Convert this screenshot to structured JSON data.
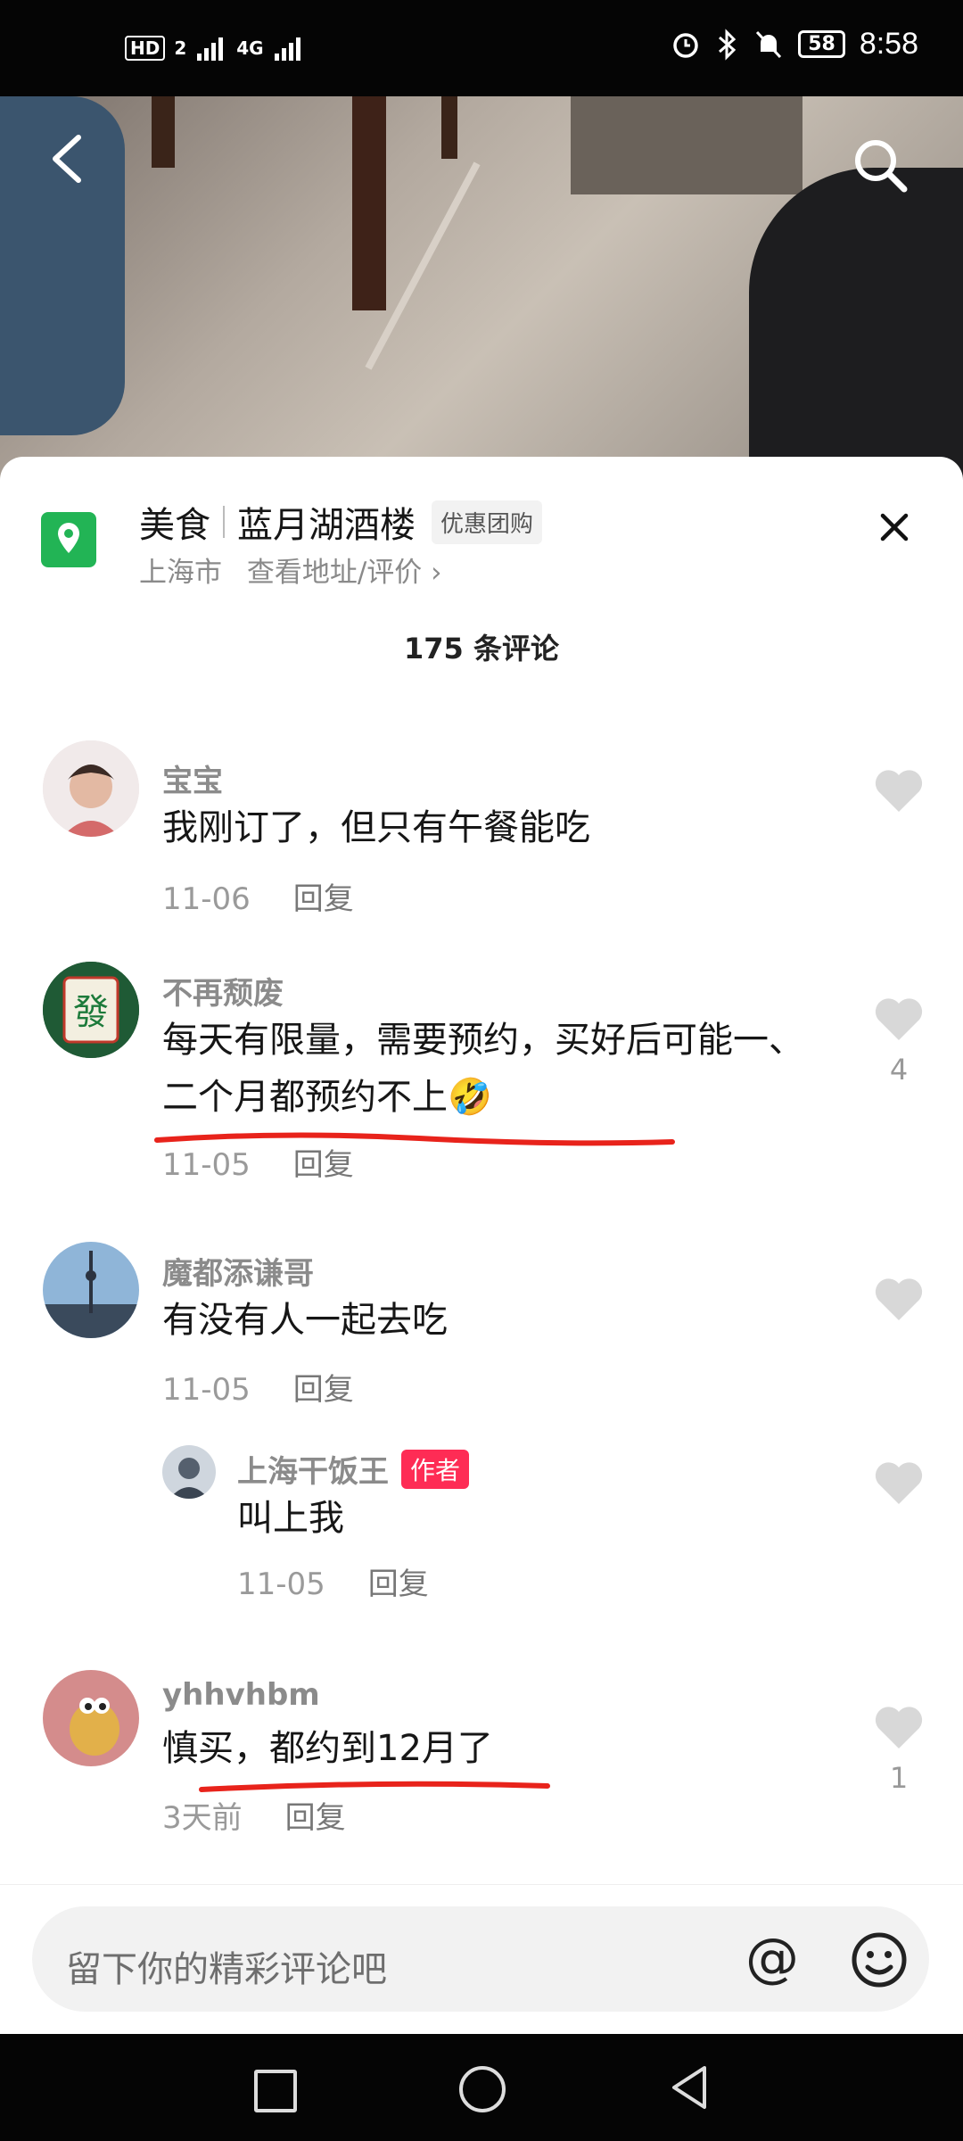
{
  "status_bar": {
    "hd": "HD",
    "sim": "2",
    "network": "4G",
    "battery": "58",
    "time": "8:58"
  },
  "poi": {
    "category": "美食",
    "name": "蓝月湖酒楼",
    "tag": "优惠团购",
    "city": "上海市",
    "link": "查看地址/评价 ›"
  },
  "comments_header": "175 条评论",
  "comments": [
    {
      "user": "宝宝",
      "text": "我刚订了，但只有午餐能吃",
      "date": "11-06",
      "reply": "回复",
      "likes": ""
    },
    {
      "user": "不再颓废",
      "text": "每天有限量，需要预约，买好后可能一、二个月都预约不上🤣",
      "date": "11-05",
      "reply": "回复",
      "likes": "4"
    },
    {
      "user": "魔都添谦哥",
      "text": "有没有人一起去吃",
      "date": "11-05",
      "reply": "回复",
      "likes": ""
    },
    {
      "user": "上海干饭王",
      "author_tag": "作者",
      "text": "叫上我",
      "date": "11-05",
      "reply": "回复",
      "likes": ""
    },
    {
      "user": "yhhvhbm",
      "text": "慎买，都约到12月了",
      "date": "3天前",
      "reply": "回复",
      "likes": "1"
    }
  ],
  "input": {
    "placeholder": "留下你的精彩评论吧",
    "at": "@"
  },
  "colors": {
    "accent": "#fe2c55",
    "pin": "#22b455",
    "annotation": "#e8231b"
  }
}
